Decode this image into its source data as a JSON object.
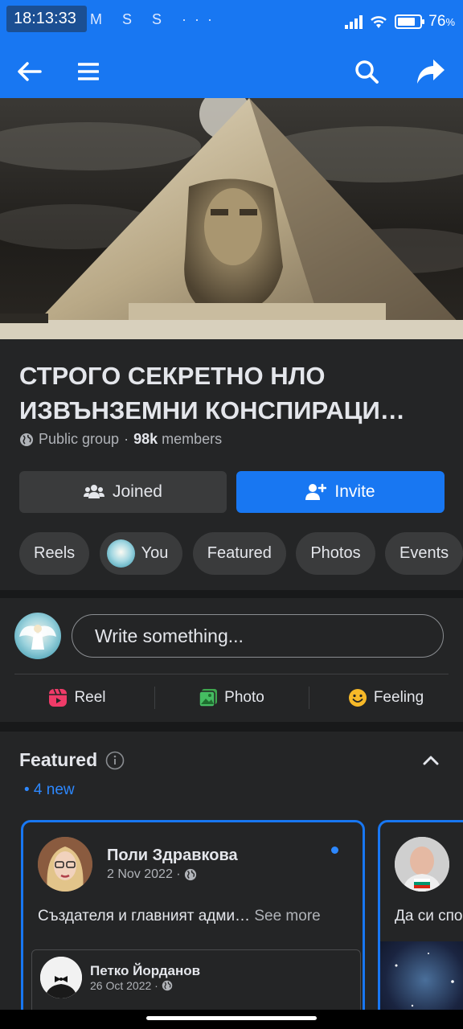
{
  "status_bar": {
    "time": "18:13:33",
    "notif_icons": "M S S ···",
    "battery": "76",
    "battery_unit": "%"
  },
  "app_bar": {
    "back_icon": "arrow-left-icon",
    "menu_icon": "hamburger-icon",
    "search_icon": "search-icon",
    "share_icon": "share-icon"
  },
  "group": {
    "title": "СТРОГО СЕКРЕТНО НЛО ИЗВЪНЗЕМНИ КОНСПИРАЦИ…",
    "privacy": "Public group",
    "separator": "·",
    "members_count": "98k",
    "members_label": "members",
    "joined_label": "Joined",
    "invite_label": "Invite"
  },
  "tabs": [
    {
      "label": "Reels"
    },
    {
      "label": "You"
    },
    {
      "label": "Featured"
    },
    {
      "label": "Photos"
    },
    {
      "label": "Events"
    }
  ],
  "composer": {
    "placeholder": "Write something...",
    "reel": "Reel",
    "photo": "Photo",
    "feeling": "Feeling"
  },
  "featured": {
    "title": "Featured",
    "new_count": "• 4 new",
    "card1": {
      "author": "Поли Здравкова",
      "date": "2 Nov 2022 ·",
      "text": "Създателя и главният адми…",
      "see_more": "See more",
      "shared_author": "Петко Йорданов",
      "shared_date": "26 Oct 2022 ·"
    },
    "card2": {
      "text": "Да си спо"
    }
  },
  "colors": {
    "accent": "#1877f2",
    "surface": "#242526",
    "background": "#18191a",
    "chip": "#3a3b3c"
  }
}
